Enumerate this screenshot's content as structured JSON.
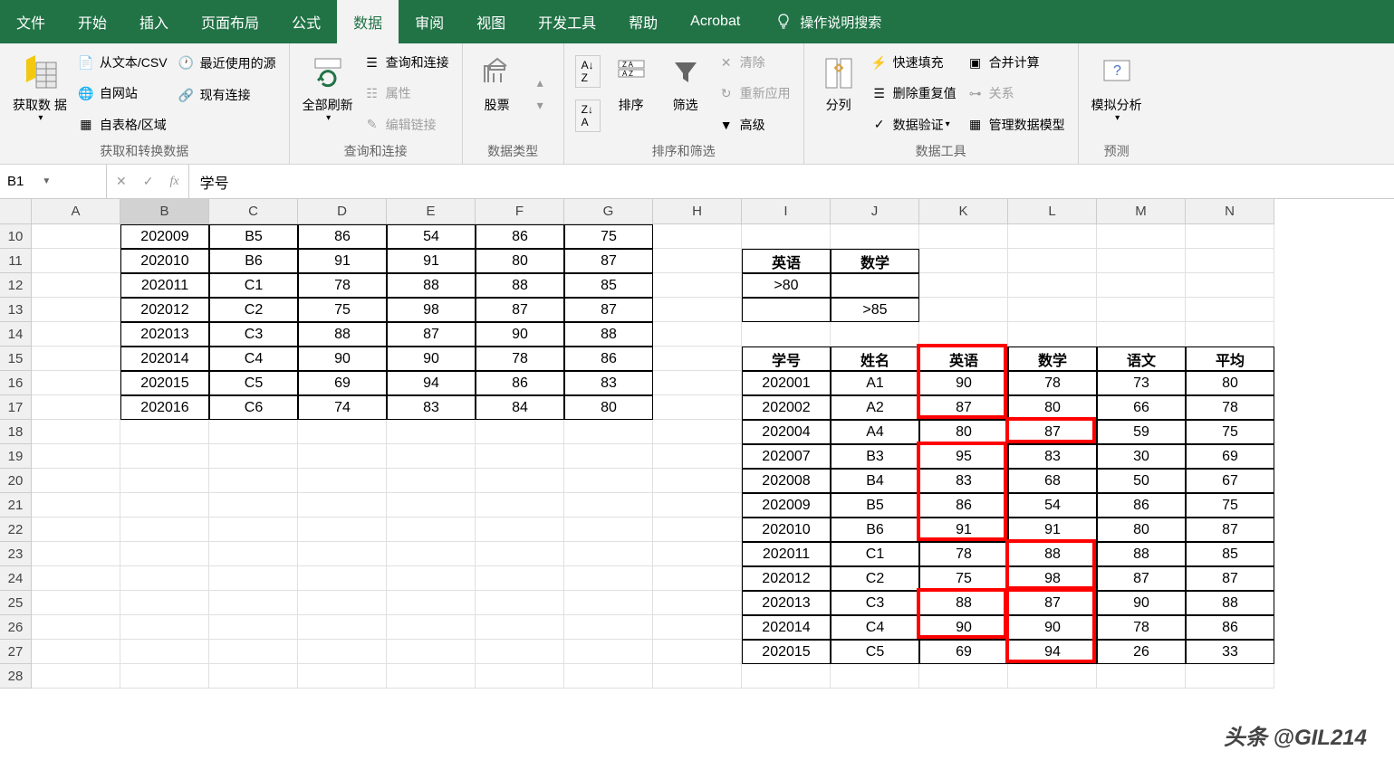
{
  "tabs": [
    "文件",
    "开始",
    "插入",
    "页面布局",
    "公式",
    "数据",
    "审阅",
    "视图",
    "开发工具",
    "帮助",
    "Acrobat"
  ],
  "activeTab": 5,
  "searchPlaceholder": "操作说明搜索",
  "ribbon": {
    "g1": {
      "label": "获取和转换数据",
      "getData": "获取数\n据",
      "csv": "从文本/CSV",
      "recent": "最近使用的源",
      "web": "自网站",
      "existing": "现有连接",
      "table": "自表格/区域"
    },
    "g2": {
      "label": "查询和连接",
      "refresh": "全部刷新",
      "conn": "查询和连接",
      "props": "属性",
      "editLinks": "编辑链接"
    },
    "g3": {
      "label": "数据类型",
      "stocks": "股票"
    },
    "g4": {
      "label": "排序和筛选",
      "sort": "排序",
      "filter": "筛选",
      "clear": "清除",
      "reapply": "重新应用",
      "advanced": "高级"
    },
    "g5": {
      "label": "数据工具",
      "textCol": "分列",
      "flash": "快速填充",
      "dedup": "删除重复值",
      "validate": "数据验证",
      "consol": "合并计算",
      "relate": "关系",
      "model": "管理数据模型"
    },
    "g6": {
      "label": "预测",
      "whatif": "模拟分析"
    }
  },
  "nameBox": "B1",
  "formula": "学号",
  "columns": [
    "A",
    "B",
    "C",
    "D",
    "E",
    "F",
    "G",
    "H",
    "I",
    "J",
    "K",
    "L",
    "M",
    "N"
  ],
  "startRow": 10,
  "rowCount": 19,
  "leftTable": [
    [
      "202009",
      "B5",
      "86",
      "54",
      "86",
      "75"
    ],
    [
      "202010",
      "B6",
      "91",
      "91",
      "80",
      "87"
    ],
    [
      "202011",
      "C1",
      "78",
      "88",
      "88",
      "85"
    ],
    [
      "202012",
      "C2",
      "75",
      "98",
      "87",
      "87"
    ],
    [
      "202013",
      "C3",
      "88",
      "87",
      "90",
      "88"
    ],
    [
      "202014",
      "C4",
      "90",
      "90",
      "78",
      "86"
    ],
    [
      "202015",
      "C5",
      "69",
      "94",
      "86",
      "83"
    ],
    [
      "202016",
      "C6",
      "74",
      "83",
      "84",
      "80"
    ]
  ],
  "criteria": {
    "h1": "英语",
    "h2": "数学",
    "v1": ">80",
    "v2": ">85"
  },
  "rightHeader": [
    "学号",
    "姓名",
    "英语",
    "数学",
    "语文",
    "平均"
  ],
  "rightTable": [
    [
      "202001",
      "A1",
      "90",
      "78",
      "73",
      "80"
    ],
    [
      "202002",
      "A2",
      "87",
      "80",
      "66",
      "78"
    ],
    [
      "202004",
      "A4",
      "80",
      "87",
      "59",
      "75"
    ],
    [
      "202007",
      "B3",
      "95",
      "83",
      "30",
      "69"
    ],
    [
      "202008",
      "B4",
      "83",
      "68",
      "50",
      "67"
    ],
    [
      "202009",
      "B5",
      "86",
      "54",
      "86",
      "75"
    ],
    [
      "202010",
      "B6",
      "91",
      "91",
      "80",
      "87"
    ],
    [
      "202011",
      "C1",
      "78",
      "88",
      "88",
      "85"
    ],
    [
      "202012",
      "C2",
      "75",
      "98",
      "87",
      "87"
    ],
    [
      "202013",
      "C3",
      "88",
      "87",
      "90",
      "88"
    ],
    [
      "202014",
      "C4",
      "90",
      "90",
      "78",
      "86"
    ],
    [
      "202015",
      "C5",
      "69",
      "94",
      "26",
      "33"
    ]
  ],
  "watermark": "头条 @GIL214"
}
